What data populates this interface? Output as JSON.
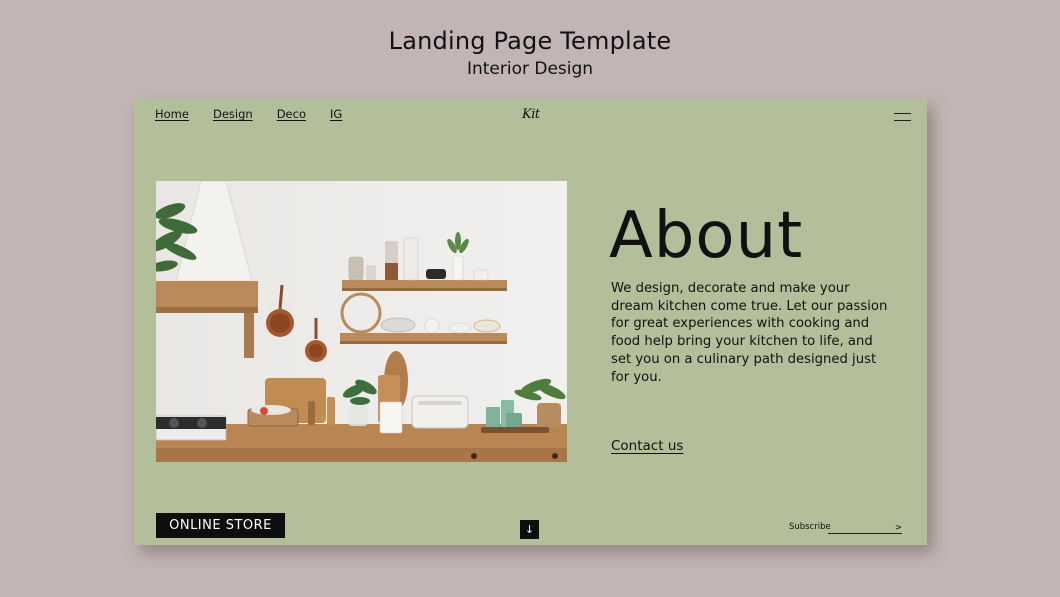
{
  "header": {
    "title": "Landing Page Template",
    "subtitle": "Interior Design"
  },
  "nav": {
    "items": [
      "Home",
      "Design",
      "Deco",
      "IG"
    ]
  },
  "logo": {
    "text": "Kit"
  },
  "about": {
    "title": "About",
    "text": "We design, decorate and make your dream kitchen come true. Let our passion for great experiences with cooking and food help bring your kitchen to life, and set you on a culinary path designed just for you.",
    "contact_label": "Contact us"
  },
  "footer": {
    "store_label": "ONLINE STORE",
    "down_icon": "↓",
    "subscribe_label": "Subscribe",
    "subscribe_arrow": ">"
  },
  "colors": {
    "background": "#c3b5b6",
    "card": "#b3bf9b",
    "button": "#0e0e0e"
  },
  "icons": [
    "menu-icon",
    "arrow-down-icon",
    "arrow-right-icon"
  ]
}
